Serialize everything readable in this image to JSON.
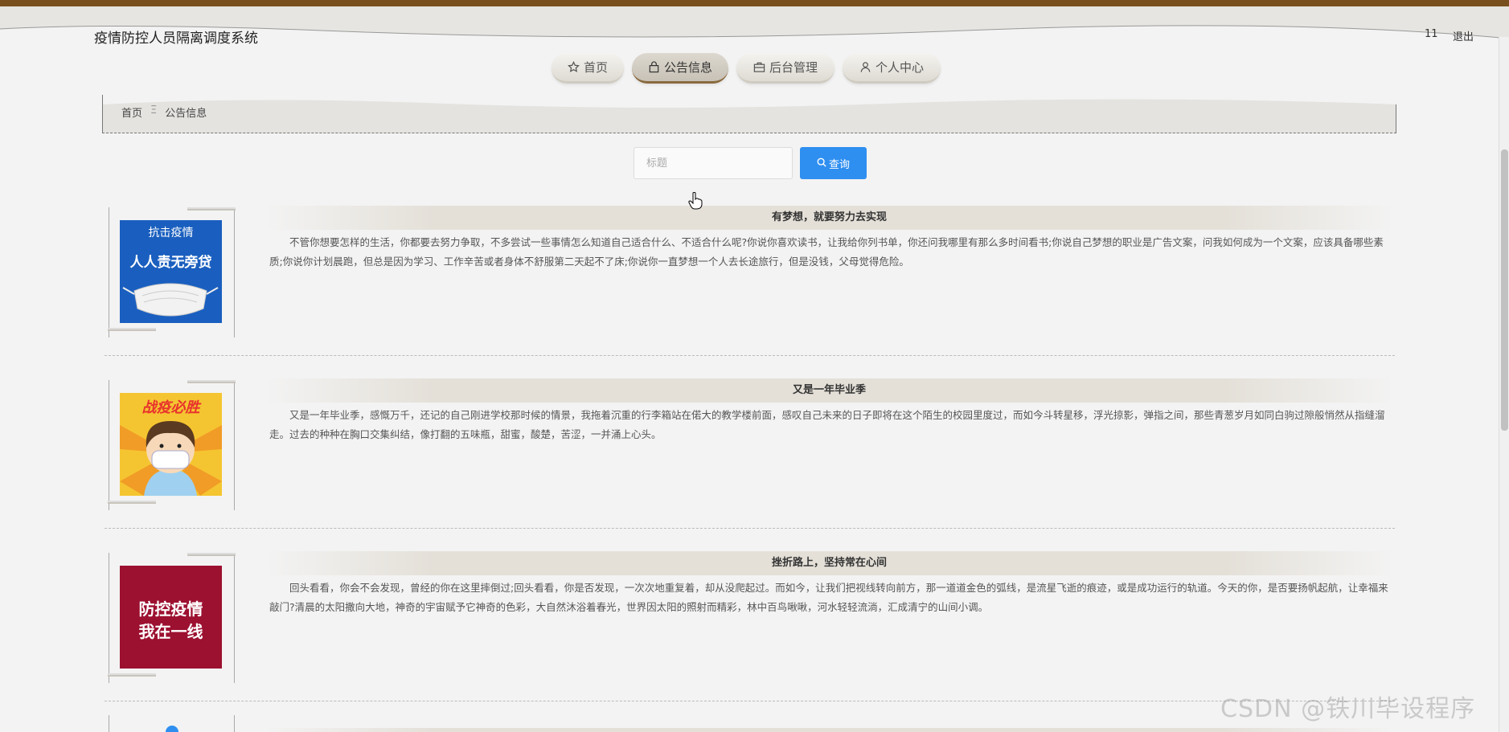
{
  "app": {
    "title": "疫情防控人员隔离调度系统",
    "user": "11",
    "logout": "退出"
  },
  "nav": [
    {
      "label": "首页",
      "icon": "star-icon"
    },
    {
      "label": "公告信息",
      "icon": "bag-icon",
      "active": true
    },
    {
      "label": "后台管理",
      "icon": "briefcase-icon"
    },
    {
      "label": "个人中心",
      "icon": "user-icon"
    }
  ],
  "breadcrumb": {
    "home": "首页",
    "separator": "Ξ",
    "current": "公告信息"
  },
  "search": {
    "placeholder": "标题",
    "value": "",
    "button": "查询"
  },
  "news": [
    {
      "title": "有梦想，就要努力去实现",
      "body": "不管你想要怎样的生活，你都要去努力争取，不多尝试一些事情怎么知道自己适合什么、不适合什么呢?你说你喜欢读书，让我给你列书单，你还问我哪里有那么多时间看书;你说自己梦想的职业是广告文案，问我如何成为一个文案，应该具备哪些素质;你说你计划晨跑，但总是因为学习、工作辛苦或者身体不舒服第二天起不了床;你说你一直梦想一个人去长途旅行，但是没钱，父母觉得危险。",
      "image": {
        "line1": "抗击疫情",
        "line2": "人人责无旁贷",
        "bg": "#1a5fbf"
      }
    },
    {
      "title": "又是一年毕业季",
      "body": "又是一年毕业季，感慨万千，还记的自己刚进学校那时候的情景，我拖着沉重的行李箱站在偌大的教学楼前面，感叹自己未来的日子即将在这个陌生的校园里度过，而如今斗转星移，浮光掠影，弹指之间，那些青葱岁月如同白驹过隙般悄然从指缝溜走。过去的种种在胸口交集纠结，像打翻的五味瓶，甜蜜，酸楚，苦涩，一并涌上心头。",
      "image": {
        "line1": "战疫必胜",
        "bg": "#f5c531"
      }
    },
    {
      "title": "挫折路上，坚持常在心间",
      "body": "回头看看，你会不会发现，曾经的你在这里摔倒过;回头看看，你是否发现，一次次地重复着，却从没爬起过。而如今，让我们把视线转向前方，那一道道金色的弧线，是流星飞逝的痕迹，或是成功运行的轨道。今天的你，是否要扬帆起航，让幸福来敲门?清晨的太阳撒向大地，神奇的宇宙赋予它神奇的色彩，大自然沐浴着春光，世界因太阳的照射而精彩，林中百鸟啾啾，河水轻轻流淌，汇成清宁的山间小调。",
      "image": {
        "line1": "防控疫情",
        "line2": "我在一线",
        "bg": "#9c1030"
      }
    }
  ],
  "watermark": "CSDN @铁川毕设程序"
}
